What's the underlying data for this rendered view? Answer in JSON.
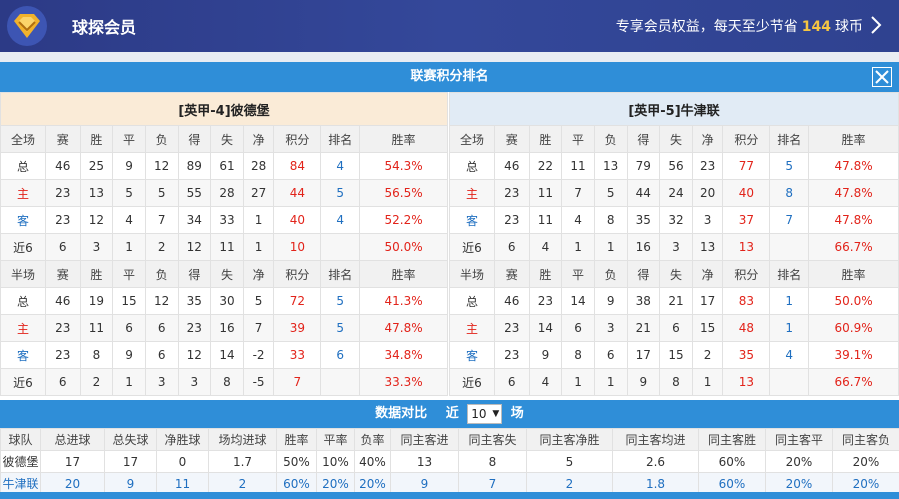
{
  "header": {
    "app_title": "球探会员",
    "promo_prefix": "专享会员权益，每天至少节省",
    "promo_number": "144",
    "promo_suffix": "球币",
    "logo_icon": "diamond-crown-icon"
  },
  "panel": {
    "title": "联赛积分排名",
    "close_icon": "close-icon"
  },
  "columns": [
    "赛",
    "胜",
    "平",
    "负",
    "得",
    "失",
    "净",
    "积分",
    "排名",
    "胜率"
  ],
  "home": {
    "title": "[英甲-4]彼德堡",
    "full": {
      "label": "全场",
      "rows": [
        {
          "label": "总",
          "cells": [
            "46",
            "25",
            "9",
            "12",
            "89",
            "61",
            "28",
            "84",
            "4",
            "54.3%"
          ]
        },
        {
          "label": "主",
          "cells": [
            "23",
            "13",
            "5",
            "5",
            "55",
            "28",
            "27",
            "44",
            "5",
            "56.5%"
          ]
        },
        {
          "label": "客",
          "cells": [
            "23",
            "12",
            "4",
            "7",
            "34",
            "33",
            "1",
            "40",
            "4",
            "52.2%"
          ]
        },
        {
          "label": "近6",
          "cells": [
            "6",
            "3",
            "1",
            "2",
            "12",
            "11",
            "1",
            "10",
            "",
            "50.0%"
          ]
        }
      ]
    },
    "half": {
      "label": "半场",
      "rows": [
        {
          "label": "总",
          "cells": [
            "46",
            "19",
            "15",
            "12",
            "35",
            "30",
            "5",
            "72",
            "5",
            "41.3%"
          ]
        },
        {
          "label": "主",
          "cells": [
            "23",
            "11",
            "6",
            "6",
            "23",
            "16",
            "7",
            "39",
            "5",
            "47.8%"
          ]
        },
        {
          "label": "客",
          "cells": [
            "23",
            "8",
            "9",
            "6",
            "12",
            "14",
            "-2",
            "33",
            "6",
            "34.8%"
          ]
        },
        {
          "label": "近6",
          "cells": [
            "6",
            "2",
            "1",
            "3",
            "3",
            "8",
            "-5",
            "7",
            "",
            "33.3%"
          ]
        }
      ]
    }
  },
  "away": {
    "title": "[英甲-5]牛津联",
    "full": {
      "label": "全场",
      "rows": [
        {
          "label": "总",
          "cells": [
            "46",
            "22",
            "11",
            "13",
            "79",
            "56",
            "23",
            "77",
            "5",
            "47.8%"
          ]
        },
        {
          "label": "主",
          "cells": [
            "23",
            "11",
            "7",
            "5",
            "44",
            "24",
            "20",
            "40",
            "8",
            "47.8%"
          ]
        },
        {
          "label": "客",
          "cells": [
            "23",
            "11",
            "4",
            "8",
            "35",
            "32",
            "3",
            "37",
            "7",
            "47.8%"
          ]
        },
        {
          "label": "近6",
          "cells": [
            "6",
            "4",
            "1",
            "1",
            "16",
            "3",
            "13",
            "13",
            "",
            "66.7%"
          ]
        }
      ]
    },
    "half": {
      "label": "半场",
      "rows": [
        {
          "label": "总",
          "cells": [
            "46",
            "23",
            "14",
            "9",
            "38",
            "21",
            "17",
            "83",
            "1",
            "50.0%"
          ]
        },
        {
          "label": "主",
          "cells": [
            "23",
            "14",
            "6",
            "3",
            "21",
            "6",
            "15",
            "48",
            "1",
            "60.9%"
          ]
        },
        {
          "label": "客",
          "cells": [
            "23",
            "9",
            "8",
            "6",
            "17",
            "15",
            "2",
            "35",
            "4",
            "39.1%"
          ]
        },
        {
          "label": "近6",
          "cells": [
            "6",
            "4",
            "1",
            "1",
            "9",
            "8",
            "1",
            "13",
            "",
            "66.7%"
          ]
        }
      ]
    }
  },
  "compare": {
    "title": "数据对比",
    "recent_prefix": "近",
    "recent_value": "10",
    "recent_suffix": "场",
    "headers": [
      "球队",
      "总进球",
      "总失球",
      "净胜球",
      "场均进球",
      "胜率",
      "平率",
      "负率",
      "同主客进",
      "同主客失",
      "同主客净胜",
      "同主客均进",
      "同主客胜",
      "同主客平",
      "同主客负"
    ],
    "rows": [
      {
        "cells": [
          "彼德堡",
          "17",
          "17",
          "0",
          "1.7",
          "50%",
          "10%",
          "40%",
          "13",
          "8",
          "5",
          "2.6",
          "60%",
          "20%",
          "20%"
        ]
      },
      {
        "cells": [
          "牛津联",
          "20",
          "9",
          "11",
          "2",
          "60%",
          "20%",
          "20%",
          "9",
          "7",
          "2",
          "1.8",
          "60%",
          "20%",
          "20%"
        ]
      }
    ]
  },
  "colors": {
    "header_bg": "#2f3f8f",
    "panel_blue": "#2f8ed8",
    "home_title_bg": "#faebd7",
    "away_title_bg": "#e1ebf5",
    "accent_red": "#e2231a",
    "accent_blue": "#1f6fc0",
    "promo_gold": "#f5c542"
  }
}
